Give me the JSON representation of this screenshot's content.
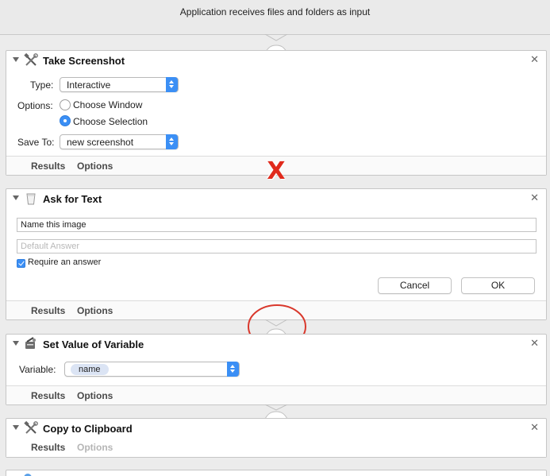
{
  "header": {
    "text": "Application receives files and folders as input"
  },
  "actions": [
    {
      "title": "Take Screenshot",
      "icon": "tools-icon",
      "type_label": "Type:",
      "type_value": "Interactive",
      "options_label": "Options:",
      "radio_choose_window": "Choose Window",
      "radio_choose_selection": "Choose Selection",
      "selected_option": "Choose Selection",
      "save_to_label": "Save To:",
      "save_to_value": "new screenshot",
      "results_tab": "Results",
      "options_tab": "Options"
    },
    {
      "title": "Ask for Text",
      "icon": "cup-icon",
      "question_value": "Name this image",
      "default_placeholder": "Default Answer",
      "require_label": "Require an answer",
      "require_checked": true,
      "cancel_label": "Cancel",
      "ok_label": "OK",
      "results_tab": "Results",
      "options_tab": "Options"
    },
    {
      "title": "Set Value of Variable",
      "icon": "variable-icon",
      "variable_label": "Variable:",
      "variable_value": "name",
      "results_tab": "Results",
      "options_tab": "Options"
    },
    {
      "title": "Copy to Clipboard",
      "icon": "tools-icon",
      "results_tab": "Results",
      "options_tab": "Options"
    }
  ],
  "annotations": {
    "error_mark": "X",
    "error_color": "#e02a1c",
    "highlight_circle_color": "#d9382c"
  },
  "colors": {
    "accent": "#3b8ff5"
  }
}
